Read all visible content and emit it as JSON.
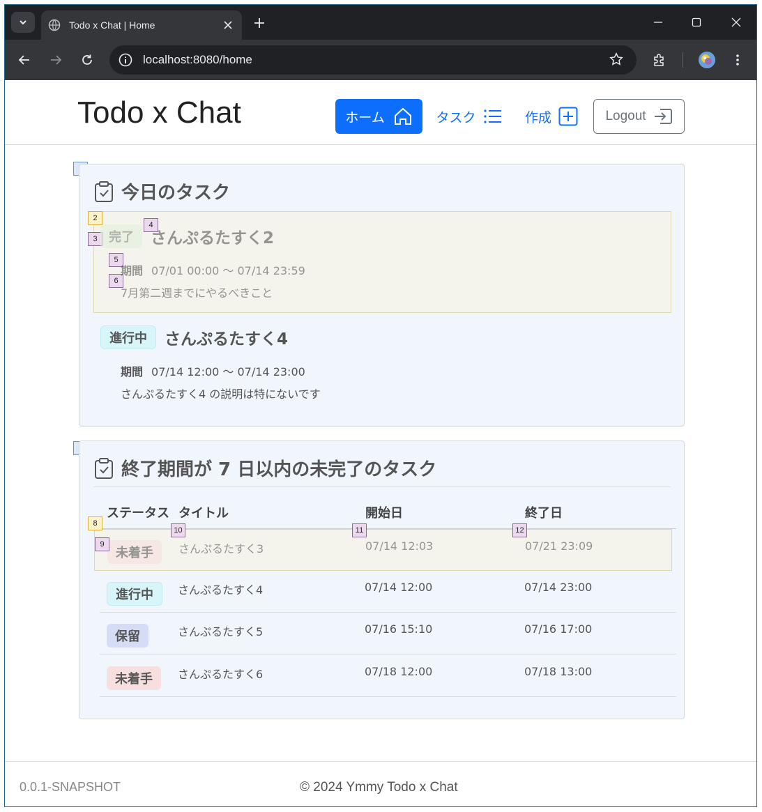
{
  "browser": {
    "tab_title": "Todo x Chat | Home",
    "url": "localhost:8080/home"
  },
  "header": {
    "brand": "Todo x Chat",
    "nav": {
      "home": "ホーム",
      "tasks": "タスク",
      "create": "作成",
      "logout": "Logout"
    }
  },
  "today": {
    "marker": "1",
    "title": "今日のタスク",
    "tasks": [
      {
        "status": "完了",
        "name": "さんぷるたすく2",
        "period_label": "期間",
        "period": "07/01 00:00 〜 07/14 23:59",
        "desc": "7月第二週までにやるべきこと"
      },
      {
        "status": "進行中",
        "name": "さんぷるたすく4",
        "period_label": "期間",
        "period": "07/14 12:00 〜 07/14 23:00",
        "desc": "さんぷるたすく4 の説明は特にないです"
      }
    ],
    "markers": {
      "m2": "2",
      "m3": "3",
      "m4": "4",
      "m5": "5",
      "m6": "6"
    }
  },
  "upcoming": {
    "marker": "7",
    "title": "終了期間が 7 日以内の未完了のタスク",
    "columns": [
      "ステータス",
      "タイトル",
      "開始日",
      "終了日"
    ],
    "rows": [
      {
        "status": "未着手",
        "title": "さんぷるたすく3",
        "start": "07/14 12:03",
        "end": "07/21 23:09"
      },
      {
        "status": "進行中",
        "title": "さんぷるたすく4",
        "start": "07/14 12:00",
        "end": "07/14 23:00"
      },
      {
        "status": "保留",
        "title": "さんぷるたすく5",
        "start": "07/16 15:10",
        "end": "07/16 17:00"
      },
      {
        "status": "未着手",
        "title": "さんぷるたすく6",
        "start": "07/18 12:00",
        "end": "07/18 13:00"
      }
    ],
    "markers": {
      "m8": "8",
      "m9": "9",
      "m10": "10",
      "m11": "11",
      "m12": "12"
    }
  },
  "footer": {
    "version": "0.0.1-SNAPSHOT",
    "copyright": "© 2024 Ymmy Todo x Chat"
  },
  "colors": {
    "primary": "#0d6efd",
    "card_bg": "#f1f6fd",
    "highlight": "#f5f4ec"
  }
}
